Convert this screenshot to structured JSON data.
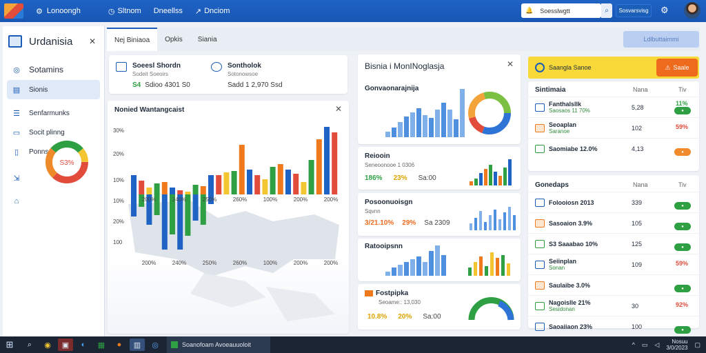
{
  "topbar": {
    "brand": "Lonoongh",
    "nav": [
      "Sltnom",
      "Dneellss",
      "Dnciom"
    ],
    "search_placeholder": "Soesslwgtt",
    "badge": "Sosvarsvisg"
  },
  "sidebar": {
    "title": "Urdanisia",
    "items": [
      {
        "label": "Sotamins",
        "icon": "settings-icon"
      },
      {
        "label": "Sionis",
        "icon": "list-icon"
      },
      {
        "label": "Senfarmunks",
        "icon": "menu-icon"
      },
      {
        "label": "Socit plinng",
        "icon": "document-icon"
      },
      {
        "label": "Ponns",
        "icon": "file-icon"
      }
    ],
    "donut_label": "S3%"
  },
  "subnav": {
    "tabs": [
      "Nej Biniaoa",
      "Opkis",
      "Siania"
    ],
    "action_button": "Ldlbuttaimmi"
  },
  "kpi": [
    {
      "title": "Soeesl Shordn",
      "sub": "Sodeit Soeoirs",
      "value": "Sdioo 4301 S0",
      "prefix": "S4"
    },
    {
      "title": "Sontholok",
      "sub": "Sotonowsoe",
      "value": "Sadd 1 2,970 Ssd"
    }
  ],
  "map_chart": {
    "title": "Nonied Wantangcaist",
    "y_ticks": [
      "30%",
      "20%",
      "10%",
      "10%",
      "20%",
      "100"
    ],
    "x_ticks": [
      "200%",
      "240%",
      "250%",
      "260%",
      "100%",
      "200%",
      "200%"
    ]
  },
  "middle": {
    "title": "Bisnia i MonINoglasja",
    "sections": [
      {
        "title": "Gonvaonarajnija"
      },
      {
        "title": "Reiooin",
        "sub": "Seneoonooe 1 0306",
        "stats": [
          "186%",
          "23%",
          "Sa:00"
        ]
      },
      {
        "title": "Posoonuoisgn",
        "sub": "Sqvnn",
        "stats": [
          "3/21.10%",
          "29%",
          "Sa 2309"
        ]
      },
      {
        "title": "Ratooipsnn"
      },
      {
        "title": "Fostpipka",
        "sub": "Seoame:: 13,030",
        "stats": [
          "10.8%",
          "20%",
          "Sa:00"
        ]
      }
    ]
  },
  "right": {
    "banner_text": "Saangla Sanoe",
    "banner_button": "Saale",
    "list1": {
      "title": "Sintimaia",
      "col1": "Nana",
      "col2": "Tiv",
      "rows": [
        {
          "name": "Fanthalsllk",
          "sub": "Saosaos  11 70%",
          "value": "5,28",
          "pct": "11%",
          "pill": "g"
        },
        {
          "name": "Seoaplan",
          "sub": "Saranoe",
          "value": "102",
          "pct": "59%",
          "pill": ""
        },
        {
          "name": "Saomiabe 12.0%",
          "sub": "",
          "value": "4,13",
          "pct": "",
          "pill": "o"
        }
      ]
    },
    "list2": {
      "title": "Gonedaps",
      "col1": "Nana",
      "col2": "Tiv",
      "rows": [
        {
          "name": "Folooiosn  2013",
          "sub": "",
          "value": "339",
          "pct": "",
          "pill": "g"
        },
        {
          "name": "Sasoaion  3.9%",
          "sub": "",
          "value": "105",
          "pct": "",
          "pill": "g"
        },
        {
          "name": "S3 Saaabao  10%",
          "sub": "",
          "value": "125",
          "pct": "",
          "pill": "g"
        },
        {
          "name": "Seiinplan",
          "sub": "Sonan",
          "value": "109",
          "pct": "59%",
          "pill": ""
        },
        {
          "name": "Saulaibe  3.0%",
          "sub": "",
          "value": "",
          "pct": "",
          "pill": "g"
        },
        {
          "name": "Nagoislle  21%",
          "sub": "Sesidonan",
          "value": "30",
          "pct": "92%",
          "pill": ""
        },
        {
          "name": "Saoaiiaon  23%",
          "sub": "",
          "value": "100",
          "pct": "",
          "pill": "g"
        }
      ]
    }
  },
  "taskbar": {
    "active_window": "Soanofoam Avoeauuoloit",
    "time": "Nosuu",
    "date": "3/0/2023"
  },
  "colors": {
    "accent": "#1a5cb8",
    "green": "#2ea043",
    "orange": "#ee6a1d",
    "yellow": "#f7d93a",
    "light_blue": "#7fb0ea"
  }
}
